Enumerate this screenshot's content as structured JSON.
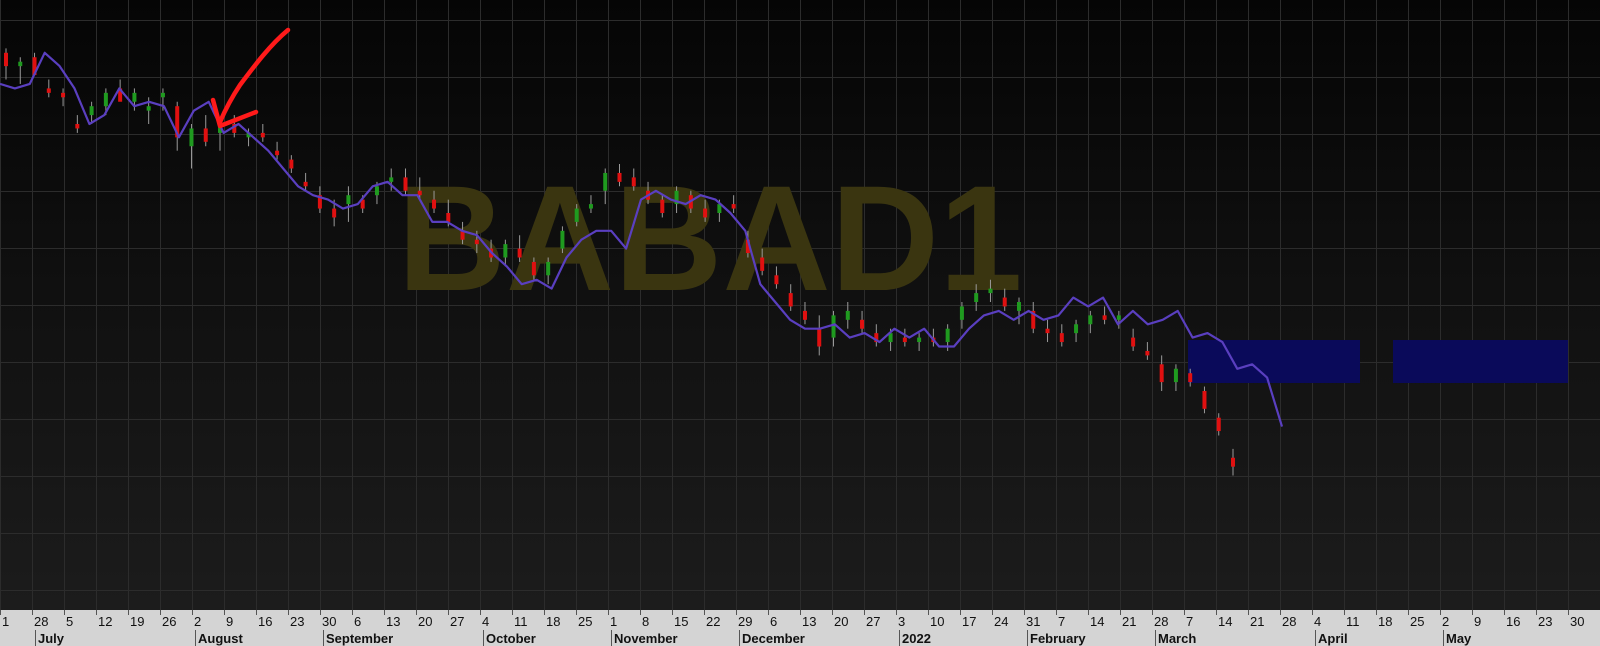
{
  "chart_data": {
    "type": "candlestick",
    "watermark": "BABAD1",
    "colors": {
      "up": "#1f9a1f",
      "down": "#e01010",
      "wick": "#9a9a9a",
      "line": "#5a3fc0",
      "annotation": "#ff1a1a",
      "watermark": "#3a3510",
      "blocks": "#0a0a5a",
      "axis_bg": "#d4d4d4",
      "grid": "#2c2c2c"
    },
    "y_range": [
      0,
      100
    ],
    "x_tick_labels": [
      "1",
      "28",
      "5",
      "12",
      "19",
      "26",
      "2",
      "9",
      "16",
      "23",
      "30",
      "6",
      "13",
      "20",
      "27",
      "4",
      "11",
      "18",
      "25",
      "1",
      "8",
      "15",
      "22",
      "29",
      "6",
      "13",
      "20",
      "27",
      "3",
      "10",
      "17",
      "24",
      "31",
      "7",
      "14",
      "21",
      "28",
      "7",
      "14",
      "21",
      "28",
      "4",
      "11",
      "18",
      "25",
      "2",
      "9",
      "16",
      "23",
      "30"
    ],
    "month_labels": [
      "July",
      "August",
      "September",
      "October",
      "November",
      "December",
      "2022",
      "February",
      "March",
      "April",
      "May"
    ],
    "candles": [
      {
        "o": 96,
        "h": 97,
        "l": 90,
        "c": 93
      },
      {
        "o": 93,
        "h": 95,
        "l": 89,
        "c": 94
      },
      {
        "o": 95,
        "h": 96,
        "l": 92,
        "c": 91
      },
      {
        "o": 88,
        "h": 90,
        "l": 86,
        "c": 87
      },
      {
        "o": 87,
        "h": 88,
        "l": 84,
        "c": 86
      },
      {
        "o": 80,
        "h": 82,
        "l": 78,
        "c": 79
      },
      {
        "o": 82,
        "h": 85,
        "l": 80,
        "c": 84
      },
      {
        "o": 84,
        "h": 88,
        "l": 82,
        "c": 87
      },
      {
        "o": 88,
        "h": 90,
        "l": 86,
        "c": 85
      },
      {
        "o": 85,
        "h": 88,
        "l": 83,
        "c": 87
      },
      {
        "o": 83,
        "h": 86,
        "l": 80,
        "c": 84
      },
      {
        "o": 86,
        "h": 88,
        "l": 83,
        "c": 87
      },
      {
        "o": 84,
        "h": 85,
        "l": 74,
        "c": 77
      },
      {
        "o": 75,
        "h": 80,
        "l": 70,
        "c": 79
      },
      {
        "o": 79,
        "h": 82,
        "l": 75,
        "c": 76
      },
      {
        "o": 78,
        "h": 80,
        "l": 74,
        "c": 80
      },
      {
        "o": 80,
        "h": 82,
        "l": 77,
        "c": 78
      },
      {
        "o": 77,
        "h": 79,
        "l": 75,
        "c": 78
      },
      {
        "o": 78,
        "h": 80,
        "l": 76,
        "c": 77
      },
      {
        "o": 74,
        "h": 76,
        "l": 72,
        "c": 73
      },
      {
        "o": 72,
        "h": 73,
        "l": 69,
        "c": 70
      },
      {
        "o": 67,
        "h": 69,
        "l": 65,
        "c": 66
      },
      {
        "o": 64,
        "h": 66,
        "l": 60,
        "c": 61
      },
      {
        "o": 61,
        "h": 63,
        "l": 57,
        "c": 59
      },
      {
        "o": 62,
        "h": 66,
        "l": 58,
        "c": 64
      },
      {
        "o": 63,
        "h": 64,
        "l": 60,
        "c": 61
      },
      {
        "o": 64,
        "h": 67,
        "l": 62,
        "c": 66
      },
      {
        "o": 67,
        "h": 70,
        "l": 65,
        "c": 68
      },
      {
        "o": 68,
        "h": 70,
        "l": 64,
        "c": 65
      },
      {
        "o": 65,
        "h": 68,
        "l": 63,
        "c": 64
      },
      {
        "o": 63,
        "h": 65,
        "l": 60,
        "c": 61
      },
      {
        "o": 60,
        "h": 63,
        "l": 57,
        "c": 58
      },
      {
        "o": 56,
        "h": 58,
        "l": 53,
        "c": 54
      },
      {
        "o": 54,
        "h": 56,
        "l": 51,
        "c": 53
      },
      {
        "o": 52,
        "h": 54,
        "l": 49,
        "c": 50
      },
      {
        "o": 50,
        "h": 54,
        "l": 48,
        "c": 53
      },
      {
        "o": 52,
        "h": 55,
        "l": 49,
        "c": 50
      },
      {
        "o": 49,
        "h": 50,
        "l": 45,
        "c": 46
      },
      {
        "o": 46,
        "h": 50,
        "l": 44,
        "c": 49
      },
      {
        "o": 52,
        "h": 57,
        "l": 51,
        "c": 56
      },
      {
        "o": 58,
        "h": 62,
        "l": 57,
        "c": 61
      },
      {
        "o": 61,
        "h": 64,
        "l": 60,
        "c": 62
      },
      {
        "o": 65,
        "h": 70,
        "l": 62,
        "c": 69
      },
      {
        "o": 69,
        "h": 71,
        "l": 66,
        "c": 67
      },
      {
        "o": 68,
        "h": 70,
        "l": 65,
        "c": 66
      },
      {
        "o": 65,
        "h": 67,
        "l": 62,
        "c": 63
      },
      {
        "o": 63,
        "h": 64,
        "l": 59,
        "c": 60
      },
      {
        "o": 62,
        "h": 66,
        "l": 60,
        "c": 65
      },
      {
        "o": 64,
        "h": 65,
        "l": 60,
        "c": 61
      },
      {
        "o": 61,
        "h": 63,
        "l": 58,
        "c": 59
      },
      {
        "o": 60,
        "h": 63,
        "l": 58,
        "c": 62
      },
      {
        "o": 62,
        "h": 64,
        "l": 60,
        "c": 61
      },
      {
        "o": 54,
        "h": 56,
        "l": 50,
        "c": 51
      },
      {
        "o": 50,
        "h": 52,
        "l": 46,
        "c": 47
      },
      {
        "o": 46,
        "h": 48,
        "l": 43,
        "c": 44
      },
      {
        "o": 42,
        "h": 44,
        "l": 38,
        "c": 39
      },
      {
        "o": 38,
        "h": 40,
        "l": 35,
        "c": 36
      },
      {
        "o": 34,
        "h": 37,
        "l": 28,
        "c": 30
      },
      {
        "o": 32,
        "h": 38,
        "l": 30,
        "c": 37
      },
      {
        "o": 36,
        "h": 40,
        "l": 34,
        "c": 38
      },
      {
        "o": 36,
        "h": 38,
        "l": 33,
        "c": 34
      },
      {
        "o": 33,
        "h": 35,
        "l": 30,
        "c": 31
      },
      {
        "o": 31,
        "h": 34,
        "l": 29,
        "c": 33
      },
      {
        "o": 32,
        "h": 34,
        "l": 30,
        "c": 31
      },
      {
        "o": 31,
        "h": 33,
        "l": 29,
        "c": 32
      },
      {
        "o": 32,
        "h": 34,
        "l": 30,
        "c": 31
      },
      {
        "o": 31,
        "h": 35,
        "l": 29,
        "c": 34
      },
      {
        "o": 36,
        "h": 40,
        "l": 34,
        "c": 39
      },
      {
        "o": 40,
        "h": 44,
        "l": 38,
        "c": 42
      },
      {
        "o": 42,
        "h": 45,
        "l": 40,
        "c": 43
      },
      {
        "o": 41,
        "h": 43,
        "l": 38,
        "c": 39
      },
      {
        "o": 38,
        "h": 41,
        "l": 35,
        "c": 40
      },
      {
        "o": 38,
        "h": 40,
        "l": 33,
        "c": 34
      },
      {
        "o": 34,
        "h": 36,
        "l": 31,
        "c": 33
      },
      {
        "o": 33,
        "h": 35,
        "l": 30,
        "c": 31
      },
      {
        "o": 33,
        "h": 36,
        "l": 31,
        "c": 35
      },
      {
        "o": 35,
        "h": 38,
        "l": 33,
        "c": 37
      },
      {
        "o": 37,
        "h": 39,
        "l": 35,
        "c": 36
      },
      {
        "o": 36,
        "h": 38,
        "l": 34,
        "c": 37
      },
      {
        "o": 32,
        "h": 34,
        "l": 29,
        "c": 30
      },
      {
        "o": 29,
        "h": 31,
        "l": 27,
        "c": 28
      },
      {
        "o": 26,
        "h": 28,
        "l": 20,
        "c": 22
      },
      {
        "o": 22,
        "h": 26,
        "l": 20,
        "c": 25
      },
      {
        "o": 24,
        "h": 25,
        "l": 21,
        "c": 22
      },
      {
        "o": 20,
        "h": 21,
        "l": 15,
        "c": 16
      },
      {
        "o": 14,
        "h": 15,
        "l": 10,
        "c": 11
      },
      {
        "o": 5,
        "h": 7,
        "l": 1,
        "c": 3
      }
    ],
    "moving_average": [
      89,
      88,
      89,
      96,
      93,
      88,
      80,
      82,
      88,
      84,
      85,
      84,
      77,
      83,
      85,
      78,
      80,
      77,
      74,
      70,
      66,
      64,
      63,
      61,
      62,
      66,
      67,
      64,
      64,
      58,
      58,
      56,
      55,
      51,
      48,
      44,
      45,
      43,
      50,
      54,
      56,
      56,
      52,
      63,
      65,
      63,
      62,
      64,
      63,
      60,
      56,
      44,
      40,
      36,
      34,
      34,
      35,
      32,
      33,
      31,
      34,
      32,
      34,
      30,
      30,
      34,
      37,
      38,
      36,
      38,
      36,
      37,
      41,
      39,
      41,
      35,
      38,
      35,
      36,
      38,
      32,
      33,
      31,
      25,
      26,
      23,
      12
    ]
  }
}
